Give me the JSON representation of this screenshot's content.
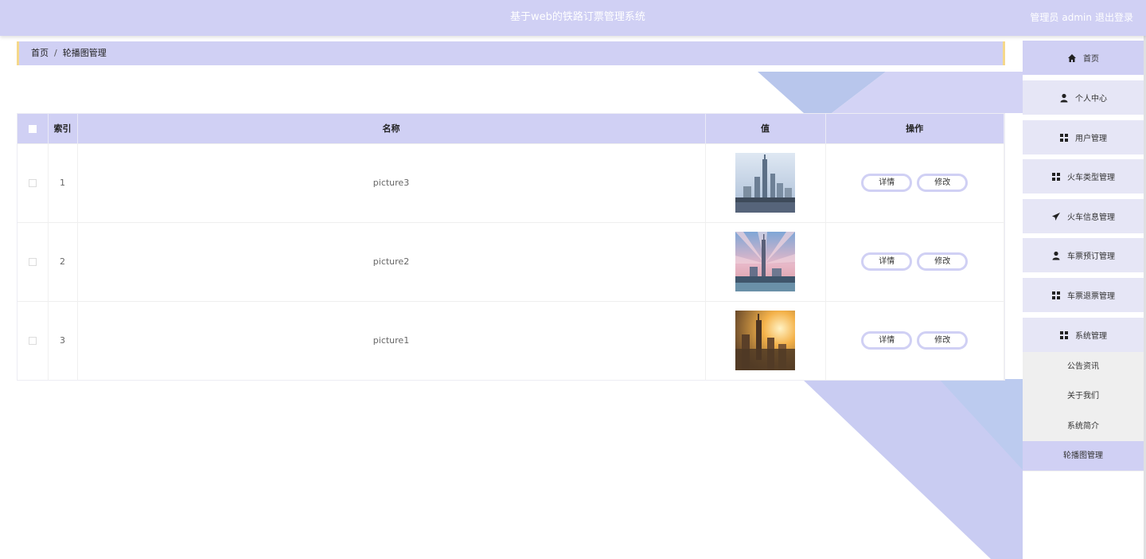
{
  "header": {
    "title": "基于web的铁路订票管理系统",
    "role_label": "管理员",
    "username": "admin",
    "logout_label": "退出登录"
  },
  "breadcrumb": {
    "home": "首页",
    "separator": "/",
    "current": "轮播图管理"
  },
  "table": {
    "headers": {
      "index": "索引",
      "name": "名称",
      "value": "值",
      "actions": "操作"
    },
    "rows": [
      {
        "index": "1",
        "name": "picture3",
        "image": "city-skyline-blue"
      },
      {
        "index": "2",
        "name": "picture2",
        "image": "tower-sunset-rays"
      },
      {
        "index": "3",
        "name": "picture1",
        "image": "city-golden-sunrise"
      }
    ],
    "detail_label": "详情",
    "edit_label": "修改"
  },
  "sidebar": {
    "items": [
      {
        "label": "首页",
        "icon": "home-icon"
      },
      {
        "label": "个人中心",
        "icon": "user-icon"
      },
      {
        "label": "用户管理",
        "icon": "grid-icon"
      },
      {
        "label": "火车类型管理",
        "icon": "grid-icon"
      },
      {
        "label": "火车信息管理",
        "icon": "paper-plane-icon"
      },
      {
        "label": "车票预订管理",
        "icon": "user-icon"
      },
      {
        "label": "车票退票管理",
        "icon": "grid-icon"
      },
      {
        "label": "系统管理",
        "icon": "grid-icon"
      }
    ],
    "sub_items": [
      {
        "label": "公告资讯"
      },
      {
        "label": "关于我们"
      },
      {
        "label": "系统简介"
      },
      {
        "label": "轮播图管理"
      }
    ]
  },
  "colors": {
    "accent": "#d0d0f4",
    "breadcrumb_border": "#f5d88a",
    "background_shape": "#c9ccf2"
  }
}
